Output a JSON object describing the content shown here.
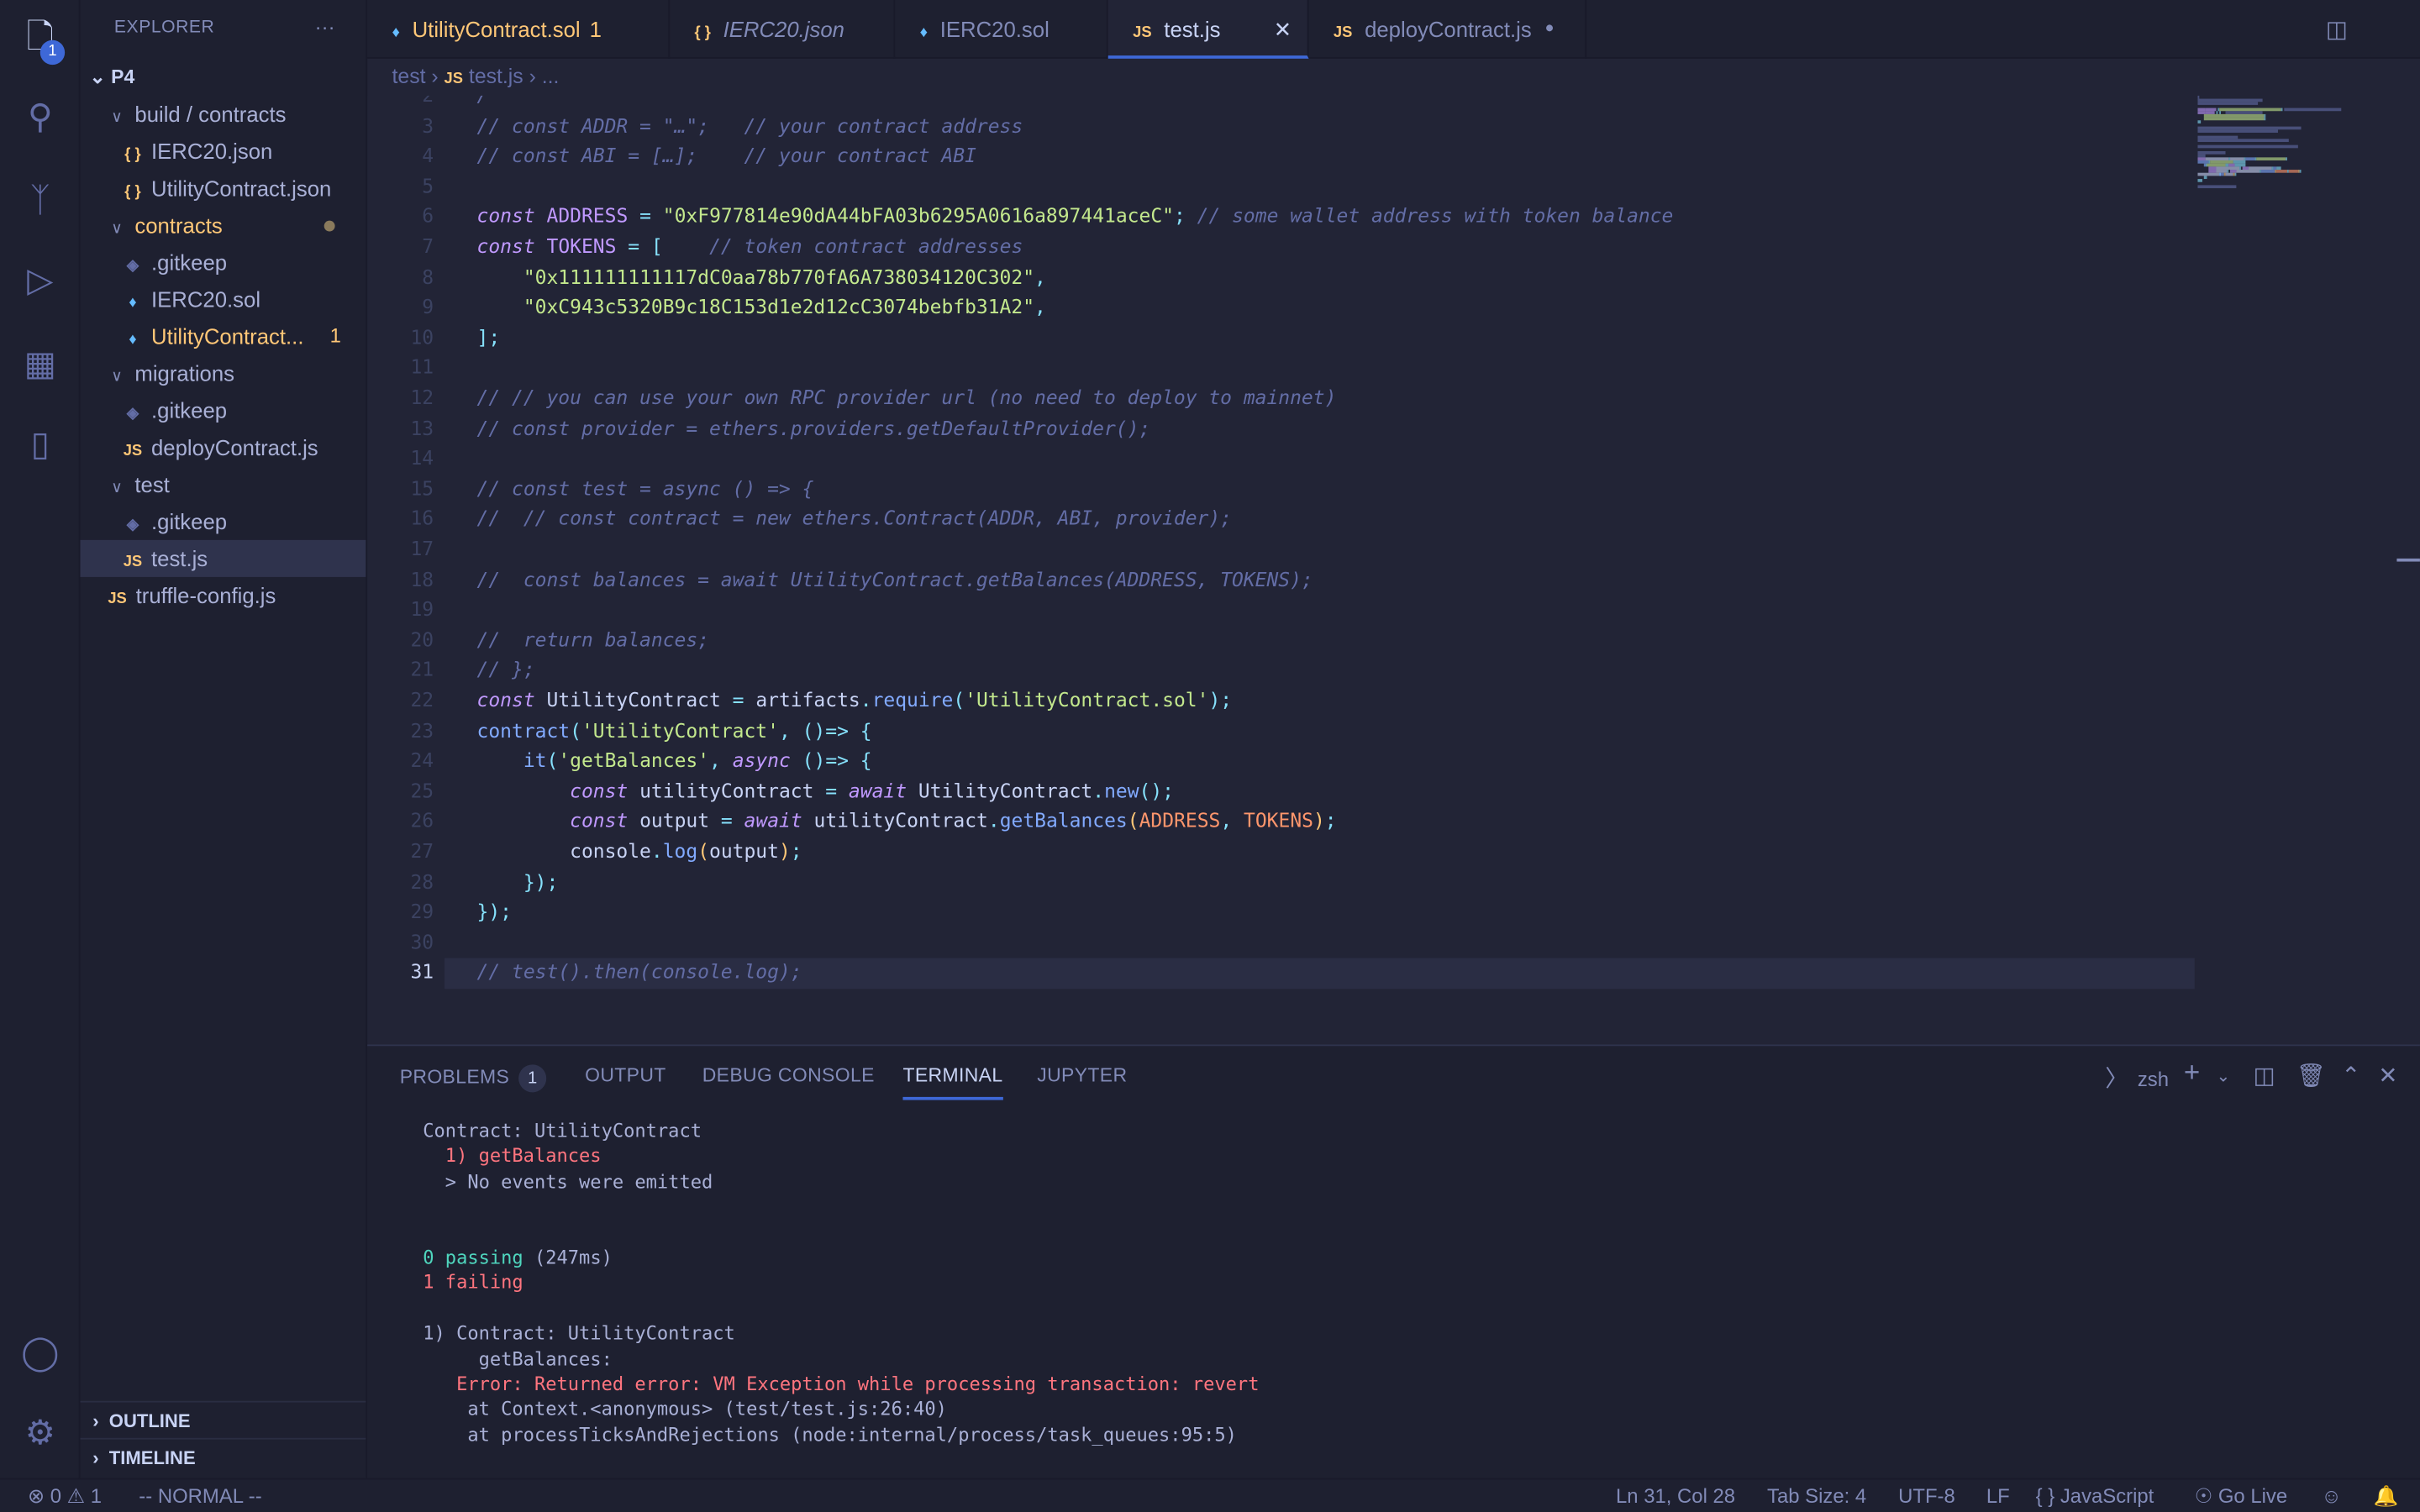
{
  "activity_bar": {
    "explorer_badge": "1",
    "icons": [
      "files-icon",
      "search-icon",
      "source-control-icon",
      "run-debug-icon",
      "extensions-icon",
      "notebook-icon",
      "account-icon",
      "settings-gear-icon"
    ]
  },
  "sidebar": {
    "title": "EXPLORER",
    "more": "···",
    "root": "P4",
    "items": [
      {
        "label": "build / contracts",
        "type": "folder",
        "depth": 1
      },
      {
        "label": "IERC20.json",
        "type": "json",
        "depth": 2
      },
      {
        "label": "UtilityContract.json",
        "type": "json",
        "depth": 2
      },
      {
        "label": "contracts",
        "type": "folder",
        "depth": 1,
        "modified": true
      },
      {
        "label": ".gitkeep",
        "type": "git",
        "depth": 2
      },
      {
        "label": "IERC20.sol",
        "type": "sol",
        "depth": 2
      },
      {
        "label": "UtilityContract...",
        "type": "sol",
        "depth": 2,
        "count": "1"
      },
      {
        "label": "migrations",
        "type": "folder",
        "depth": 1
      },
      {
        "label": ".gitkeep",
        "type": "git",
        "depth": 2
      },
      {
        "label": "deployContract.js",
        "type": "js",
        "depth": 2
      },
      {
        "label": "test",
        "type": "folder",
        "depth": 1
      },
      {
        "label": ".gitkeep",
        "type": "git",
        "depth": 2
      },
      {
        "label": "test.js",
        "type": "js",
        "depth": 2,
        "selected": true
      },
      {
        "label": "truffle-config.js",
        "type": "js",
        "depth": 1
      }
    ],
    "outline": "OUTLINE",
    "timeline": "TIMELINE"
  },
  "tabs": [
    {
      "label": "UtilityContract.sol",
      "suffix": "1",
      "type": "sol",
      "warn": true
    },
    {
      "label": "IERC20.json",
      "type": "json",
      "italic": true
    },
    {
      "label": "IERC20.sol",
      "type": "sol"
    },
    {
      "label": "test.js",
      "type": "js",
      "active": true
    },
    {
      "label": "deployContract.js",
      "type": "js",
      "dirty": true
    }
  ],
  "breadcrumb": [
    "test",
    "test.js",
    "..."
  ],
  "editor": {
    "first_line": 2,
    "current_line": 31,
    "lines": [
      [
        [
          "c",
          "/"
        ]
      ],
      [
        [
          "c",
          "// const ADDR = \"…\";   // your contract address"
        ]
      ],
      [
        [
          "c",
          "// const ABI = […];    // your contract ABI"
        ]
      ],
      [],
      [
        [
          "k",
          "const"
        ],
        [
          "t",
          " "
        ],
        [
          "v",
          "ADDRESS"
        ],
        [
          "t",
          " "
        ],
        [
          "p",
          "="
        ],
        [
          "t",
          " "
        ],
        [
          "s",
          "\"0xF977814e90dA44bFA03b6295A0616a897441aceC\""
        ],
        [
          "p",
          ";"
        ],
        [
          "t",
          " "
        ],
        [
          "c",
          "// some wallet address with token balance"
        ]
      ],
      [
        [
          "k",
          "const"
        ],
        [
          "t",
          " "
        ],
        [
          "v",
          "TOKENS"
        ],
        [
          "t",
          " "
        ],
        [
          "p",
          "="
        ],
        [
          "t",
          " "
        ],
        [
          "p",
          "["
        ],
        [
          "t",
          "    "
        ],
        [
          "c",
          "// token contract addresses"
        ]
      ],
      [
        [
          "t",
          "    "
        ],
        [
          "s",
          "\"0x111111111117dC0aa78b770fA6A738034120C302\""
        ],
        [
          "p",
          ","
        ]
      ],
      [
        [
          "t",
          "    "
        ],
        [
          "s",
          "\"0xC943c5320B9c18C153d1e2d12cC3074bebfb31A2\""
        ],
        [
          "p",
          ","
        ]
      ],
      [
        [
          "p",
          "];"
        ]
      ],
      [],
      [
        [
          "c",
          "// // you can use your own RPC provider url (no need to deploy to mainnet)"
        ]
      ],
      [
        [
          "c",
          "// const provider = ethers.providers.getDefaultProvider();"
        ]
      ],
      [],
      [
        [
          "c",
          "// const test = async () => {"
        ]
      ],
      [
        [
          "c",
          "//  // const contract = new ethers.Contract(ADDR, ABI, provider);"
        ]
      ],
      [],
      [
        [
          "c",
          "//  const balances = await UtilityContract.getBalances(ADDRESS, TOKENS);"
        ]
      ],
      [],
      [
        [
          "c",
          "//  return balances;"
        ]
      ],
      [
        [
          "c",
          "// };"
        ]
      ],
      [
        [
          "k",
          "const"
        ],
        [
          "t",
          " UtilityContract "
        ],
        [
          "p",
          "="
        ],
        [
          "t",
          " artifacts"
        ],
        [
          "p",
          "."
        ],
        [
          "f",
          "require"
        ],
        [
          "p",
          "("
        ],
        [
          "s",
          "'UtilityContract.sol'"
        ],
        [
          "p",
          ");"
        ]
      ],
      [
        [
          "f",
          "contract"
        ],
        [
          "p",
          "("
        ],
        [
          "s",
          "'UtilityContract'"
        ],
        [
          "p",
          ", ()=> {"
        ]
      ],
      [
        [
          "t",
          "    "
        ],
        [
          "f",
          "it"
        ],
        [
          "p",
          "("
        ],
        [
          "s",
          "'getBalances'"
        ],
        [
          "p",
          ", "
        ],
        [
          "k",
          "async"
        ],
        [
          "p",
          " ()=> {"
        ]
      ],
      [
        [
          "t",
          "        "
        ],
        [
          "k",
          "const"
        ],
        [
          "t",
          " utilityContract "
        ],
        [
          "p",
          "="
        ],
        [
          "t",
          " "
        ],
        [
          "k",
          "await"
        ],
        [
          "t",
          " UtilityContract"
        ],
        [
          "p",
          "."
        ],
        [
          "f",
          "new"
        ],
        [
          "p",
          "();"
        ]
      ],
      [
        [
          "t",
          "        "
        ],
        [
          "k",
          "const"
        ],
        [
          "t",
          " output "
        ],
        [
          "p",
          "="
        ],
        [
          "t",
          " "
        ],
        [
          "k",
          "await"
        ],
        [
          "t",
          " utilityContract"
        ],
        [
          "p",
          "."
        ],
        [
          "f",
          "getBalances"
        ],
        [
          "b",
          "("
        ],
        [
          "o",
          "ADDRESS"
        ],
        [
          "p",
          ", "
        ],
        [
          "o",
          "TOKENS"
        ],
        [
          "b",
          ")"
        ],
        [
          "p",
          ";"
        ]
      ],
      [
        [
          "t",
          "        console"
        ],
        [
          "p",
          "."
        ],
        [
          "f",
          "log"
        ],
        [
          "b",
          "("
        ],
        [
          "t",
          "output"
        ],
        [
          "b",
          ")"
        ],
        [
          "p",
          ";"
        ]
      ],
      [
        [
          "t",
          "    "
        ],
        [
          "p",
          "});"
        ]
      ],
      [
        [
          "p",
          "});"
        ]
      ],
      [],
      [
        [
          "c",
          "// test().then(console.log);"
        ]
      ]
    ]
  },
  "panel": {
    "tabs": [
      {
        "label": "PROBLEMS",
        "badge": "1"
      },
      {
        "label": "OUTPUT"
      },
      {
        "label": "DEBUG CONSOLE"
      },
      {
        "label": "TERMINAL",
        "active": true
      },
      {
        "label": "JUPYTER"
      }
    ],
    "shell": "zsh",
    "terminal": [
      {
        "text": "Contract: UtilityContract",
        "cls": ""
      },
      {
        "text": "  1) getBalances",
        "cls": "red"
      },
      {
        "text": "  > No events were emitted",
        "cls": ""
      },
      {
        "text": "",
        "cls": ""
      },
      {
        "text": "",
        "cls": ""
      },
      {
        "pass": "0 passing",
        "time": " (247ms)"
      },
      {
        "text": "1 failing",
        "cls": "red"
      },
      {
        "text": "",
        "cls": ""
      },
      {
        "text": "1) Contract: UtilityContract",
        "cls": ""
      },
      {
        "text": "     getBalances:",
        "cls": ""
      },
      {
        "text": "   Error: Returned error: VM Exception while processing transaction: revert",
        "cls": "red"
      },
      {
        "text": "    at Context.<anonymous> (test/test.js:26:40)",
        "cls": ""
      },
      {
        "text": "    at processTicksAndRejections (node:internal/process/task_queues:95:5)",
        "cls": ""
      }
    ]
  },
  "status": {
    "errors": "0",
    "warnings": "1",
    "mode": "-- NORMAL --",
    "position": "Ln 31, Col 28",
    "tab_size": "Tab Size: 4",
    "encoding": "UTF-8",
    "eol": "LF",
    "language": "JavaScript",
    "go_live": "Go Live"
  }
}
